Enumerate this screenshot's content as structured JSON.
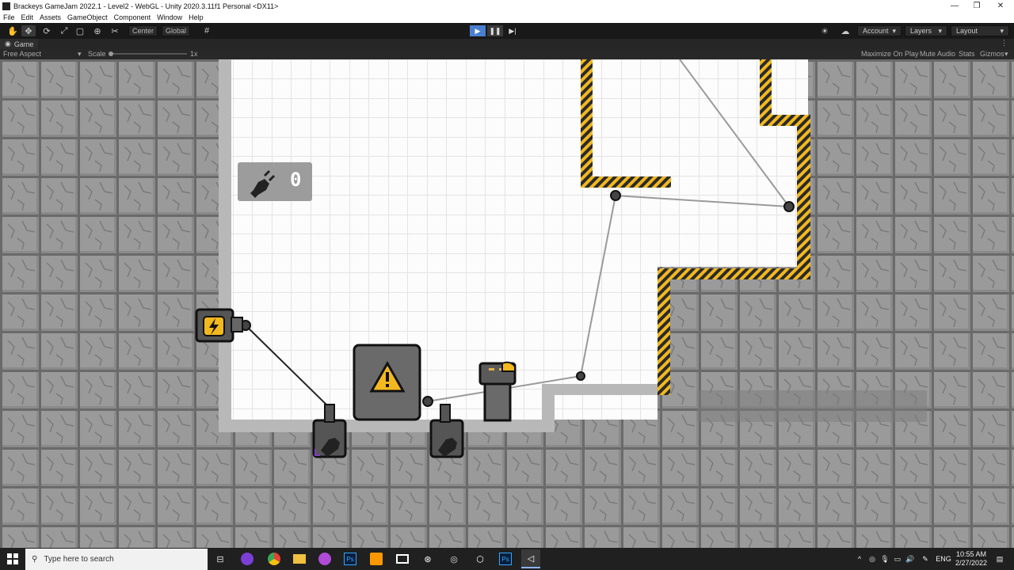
{
  "window": {
    "title": "Brackeys GameJam 2022.1 - Level2 - WebGL - Unity 2020.3.11f1 Personal <DX11>",
    "controls": {
      "minimize": "—",
      "restore": "❐",
      "close": "✕"
    }
  },
  "menu": [
    "File",
    "Edit",
    "Assets",
    "GameObject",
    "Component",
    "Window",
    "Help"
  ],
  "toolbar": {
    "pivot_label": "Center",
    "space_label": "Global",
    "account_label": "Account",
    "layers_label": "Layers",
    "layout_label": "Layout"
  },
  "game_tab": {
    "label": "Game"
  },
  "game_bar": {
    "aspect_label": "Free Aspect",
    "scale_label": "Scale",
    "scale_value": "1x",
    "maximize_label": "Maximize On Play",
    "mute_label": "Mute Audio",
    "stats_label": "Stats",
    "gizmos_label": "Gizmos"
  },
  "game_hud": {
    "plug_count": "0"
  },
  "taskbar": {
    "search_placeholder": "Type here to search",
    "language": "ENG",
    "time": "10:55 AM",
    "date": "2/27/2022"
  },
  "colors": {
    "accent_play": "#4a7fd0",
    "hazard_yellow": "#f2b81e",
    "wall_gray": "#8c8c8c",
    "floor_white": "#ffffff"
  }
}
